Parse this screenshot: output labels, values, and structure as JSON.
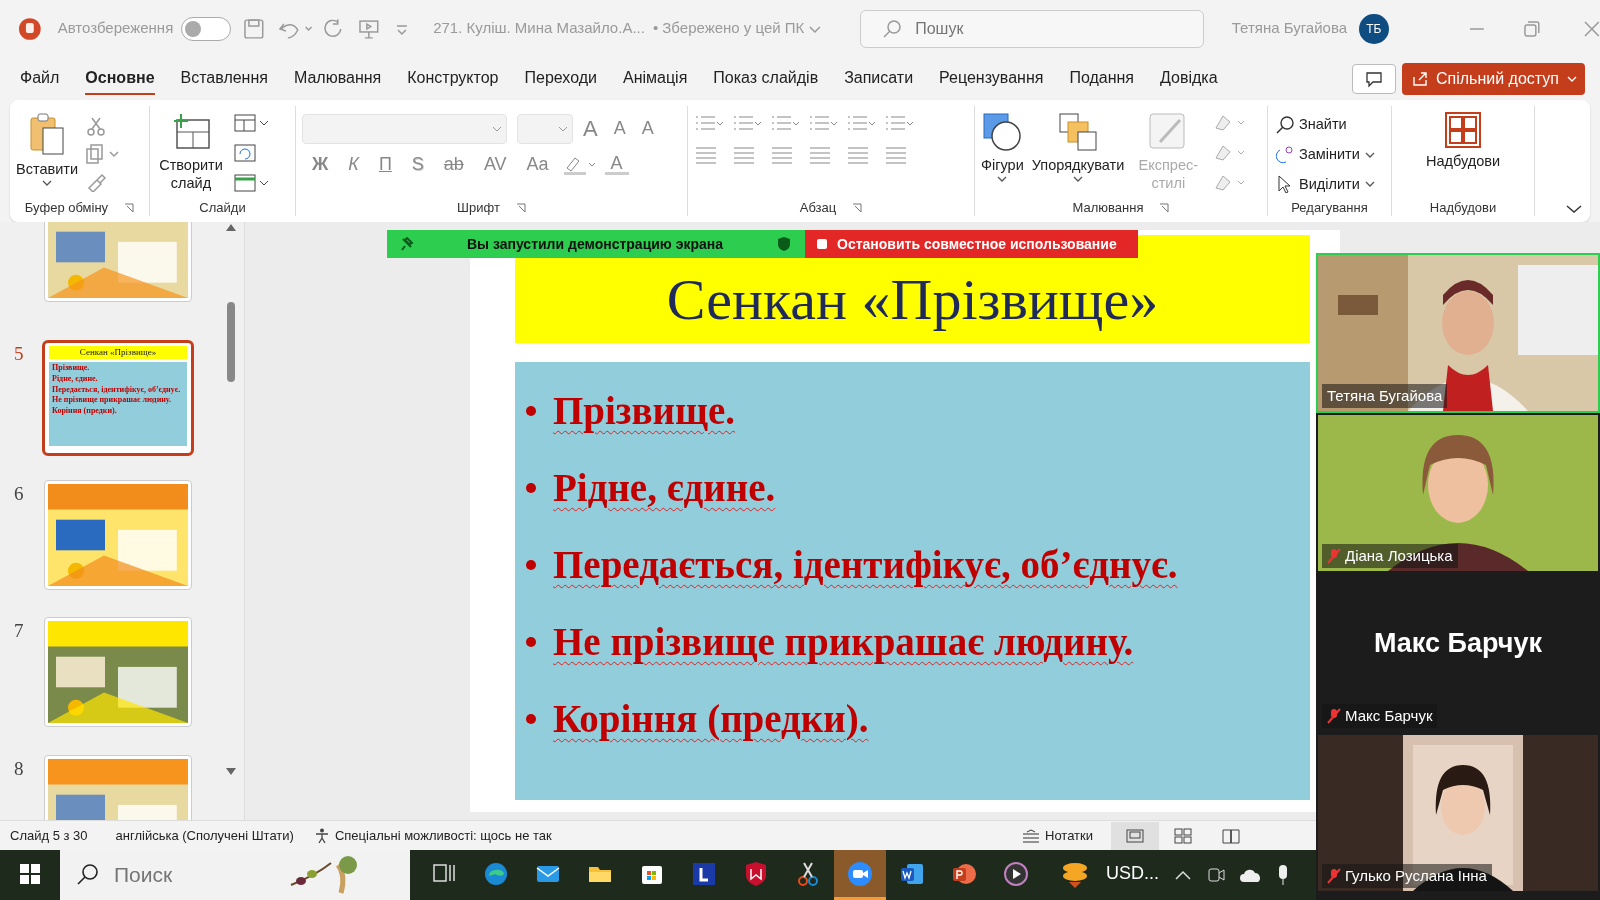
{
  "title_bar": {
    "autosave_label": "Автозбереження",
    "autosave_on": false,
    "document_title": "271. Куліш. Мина Мазайло.А...",
    "save_status": "• Збережено у цей ПК",
    "search_placeholder": "Пошук",
    "user_name": "Тетяна Бугайова",
    "user_initials": "ТБ"
  },
  "menu_tabs": [
    {
      "label": "Файл",
      "selected": false
    },
    {
      "label": "Основне",
      "selected": true
    },
    {
      "label": "Вставлення",
      "selected": false
    },
    {
      "label": "Малювання",
      "selected": false
    },
    {
      "label": "Конструктор",
      "selected": false
    },
    {
      "label": "Переходи",
      "selected": false
    },
    {
      "label": "Анімація",
      "selected": false
    },
    {
      "label": "Показ слайдів",
      "selected": false
    },
    {
      "label": "Записати",
      "selected": false
    },
    {
      "label": "Рецензування",
      "selected": false
    },
    {
      "label": "Подання",
      "selected": false
    },
    {
      "label": "Довідка",
      "selected": false
    }
  ],
  "share_button": "Спільний доступ",
  "ribbon": {
    "clipboard": {
      "paste": "Вставити",
      "label": "Буфер обміну"
    },
    "slides": {
      "new_slide": "Створити слайд",
      "label": "Слайди"
    },
    "font": {
      "size_buttons": [
        "A",
        "A"
      ],
      "clear_button": "A",
      "format_buttons": [
        "Ж",
        "К",
        "П",
        "S",
        "ab",
        "AV",
        "Aa"
      ],
      "font_color_button": "A",
      "label": "Шрифт"
    },
    "paragraph": {
      "label": "Абзац"
    },
    "drawing": {
      "shapes": "Фігури",
      "arrange": "Упорядкувати",
      "quick_styles": "Експрес-стилі",
      "quick_styles_disabled": true,
      "label": "Малювання"
    },
    "editing": {
      "find": "Знайти",
      "replace": "Замінити",
      "select": "Виділити",
      "label": "Редагування"
    },
    "addins": {
      "button": "Надбудови",
      "label": "Надбудови"
    }
  },
  "thumbnails": [
    {
      "kind": "picture",
      "selected": false
    },
    {
      "number": "5",
      "kind": "text",
      "selected": true,
      "title": "Сенкан «Прізвище»",
      "bullets": [
        "Прізвище.",
        "Рідне, єдине.",
        "Передається, ідентифікує, об’єднує.",
        "Не прізвище прикрашає людину.",
        "Коріння (предки)."
      ]
    },
    {
      "number": "6",
      "kind": "picture",
      "selected": false
    },
    {
      "number": "7",
      "kind": "picture",
      "selected": false
    },
    {
      "number": "8",
      "kind": "picture",
      "selected": false
    }
  ],
  "slide": {
    "title": "Сенкан «Прізвище»",
    "bullets": [
      "Прізвище.",
      "Рідне, єдине.",
      "Передається, ідентифікує, об’єднує.",
      "Не прізвище прикрашає людину.",
      "Коріння (предки)."
    ]
  },
  "share_banner": {
    "status": "Вы запустили демонстрацию экрана",
    "stop_button": "Остановить совместное использование"
  },
  "video_tiles": [
    {
      "kind": "video",
      "name": "Тетяна Бугайова",
      "muted": false,
      "selected": true
    },
    {
      "kind": "video",
      "name": "Діана Лозицька",
      "muted": true,
      "selected": false
    },
    {
      "kind": "name_card",
      "card_name": "Макс Барчук",
      "name": "Макс Барчук",
      "muted": true,
      "selected": false
    },
    {
      "kind": "video",
      "name": "Гулько Руслана Інна",
      "muted": true,
      "selected": false
    }
  ],
  "status_bar": {
    "slide_info": "Слайд 5 з 30",
    "language": "англійська (Сполучені Штати)",
    "accessibility": "Спеціальні можливості: щось не так",
    "notes": "Нотатки",
    "views": [
      {
        "kind": "normal",
        "selected": true
      },
      {
        "kind": "sorter",
        "selected": false
      },
      {
        "kind": "reading",
        "selected": false
      }
    ]
  },
  "taskbar": {
    "search_placeholder": "Поиск",
    "apps": [
      {
        "kind": "task-view",
        "selected": false
      },
      {
        "kind": "edge",
        "selected": false
      },
      {
        "kind": "mail",
        "selected": false
      },
      {
        "kind": "folder",
        "selected": false
      },
      {
        "kind": "store",
        "selected": false
      },
      {
        "kind": "l-app",
        "selected": false
      },
      {
        "kind": "shield",
        "selected": false
      },
      {
        "kind": "scissors",
        "selected": false
      },
      {
        "kind": "zoom",
        "selected": true
      },
      {
        "kind": "word",
        "selected": false
      },
      {
        "kind": "powerpoint",
        "selected": false
      },
      {
        "kind": "player",
        "selected": false
      }
    ],
    "weather": "USD..."
  }
}
